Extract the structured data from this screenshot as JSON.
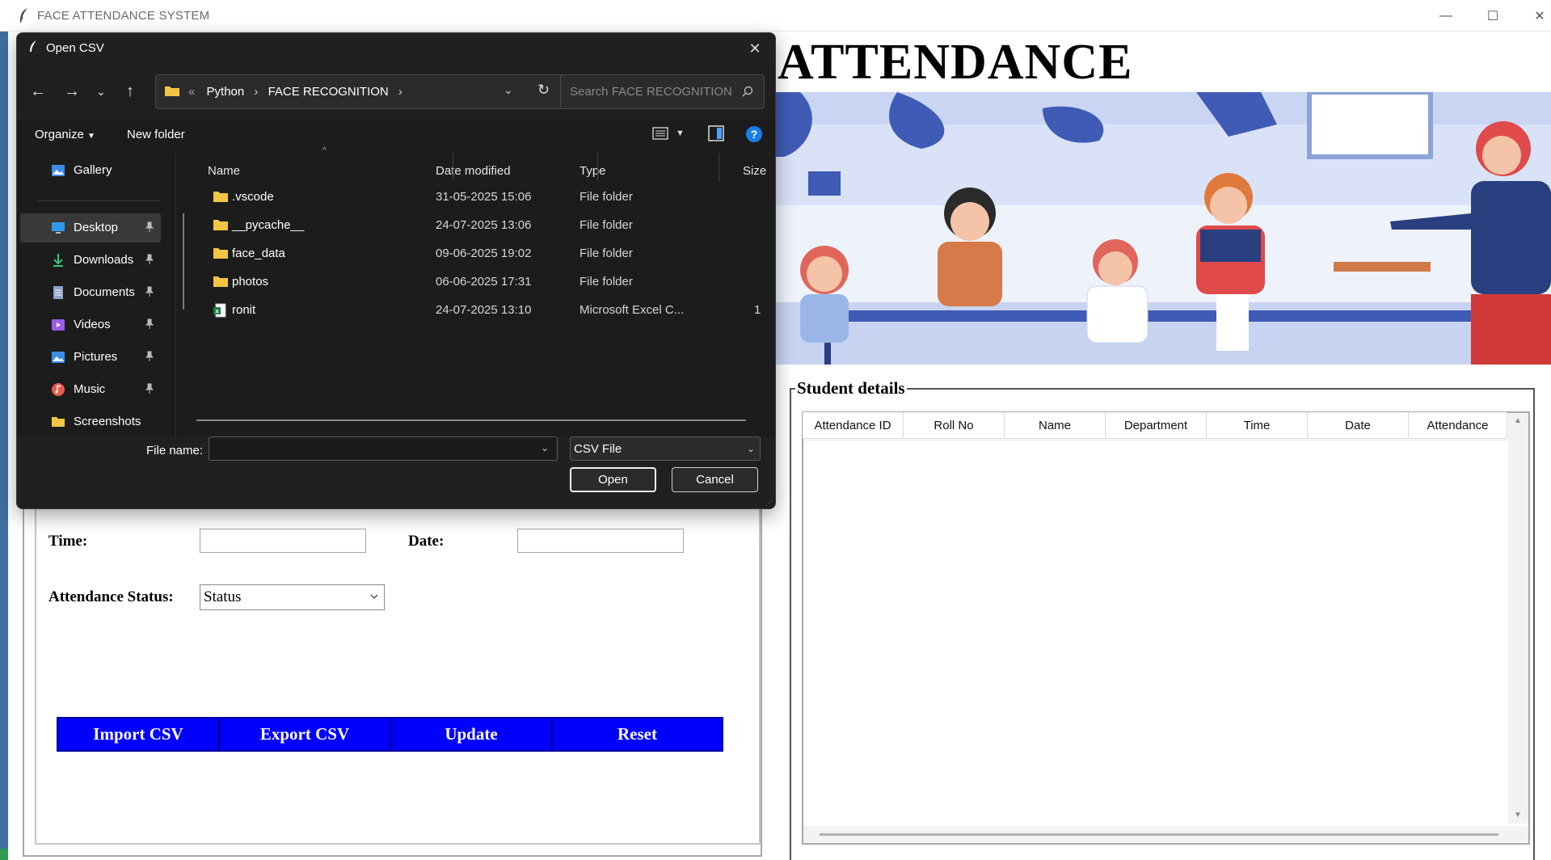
{
  "app": {
    "title": "FACE ATTENDANCE SYSTEM",
    "heading": "ATTENDANCE",
    "window_controls": {
      "minimize": "—",
      "maximize": "☐",
      "close": "✕"
    }
  },
  "form": {
    "time_label": "Time:",
    "time_value": "",
    "date_label": "Date:",
    "date_value": "",
    "status_label": "Attendance Status:",
    "status_value": "Status"
  },
  "buttons": {
    "import": "Import CSV",
    "export": "Export CSV",
    "update": "Update",
    "reset": "Reset"
  },
  "details": {
    "legend": "Student details",
    "columns": [
      "Attendance ID",
      "Roll No",
      "Name",
      "Department",
      "Time",
      "Date",
      "Attendance"
    ],
    "rows": []
  },
  "dialog": {
    "title": "Open CSV",
    "address": {
      "overflow": "«",
      "crumbs": [
        "Python",
        "FACE RECOGNITION"
      ]
    },
    "search_placeholder": "Search FACE RECOGNITION",
    "toolbar": {
      "organize": "Organize",
      "new_folder": "New folder"
    },
    "nav_items": [
      {
        "label": "Gallery",
        "icon": "gallery-icon",
        "pinned": false
      },
      {
        "label": "Desktop",
        "icon": "desktop-icon",
        "pinned": true,
        "selected": true
      },
      {
        "label": "Downloads",
        "icon": "downloads-icon",
        "pinned": true
      },
      {
        "label": "Documents",
        "icon": "documents-icon",
        "pinned": true
      },
      {
        "label": "Videos",
        "icon": "videos-icon",
        "pinned": true
      },
      {
        "label": "Pictures",
        "icon": "pictures-icon",
        "pinned": true
      },
      {
        "label": "Music",
        "icon": "music-icon",
        "pinned": true
      },
      {
        "label": "Screenshots",
        "icon": "folder-icon",
        "pinned": false
      }
    ],
    "columns": {
      "name": "Name",
      "date": "Date modified",
      "type": "Type",
      "size": "Size"
    },
    "files": [
      {
        "name": ".vscode",
        "date": "31-05-2025 15:06",
        "type": "File folder",
        "size": "",
        "icon": "folder-icon"
      },
      {
        "name": "__pycache__",
        "date": "24-07-2025 13:06",
        "type": "File folder",
        "size": "",
        "icon": "folder-icon"
      },
      {
        "name": "face_data",
        "date": "09-06-2025 19:02",
        "type": "File folder",
        "size": "",
        "icon": "folder-icon"
      },
      {
        "name": "photos",
        "date": "06-06-2025 17:31",
        "type": "File folder",
        "size": "",
        "icon": "folder-icon"
      },
      {
        "name": "ronit",
        "date": "24-07-2025 13:10",
        "type": "Microsoft Excel C...",
        "size": "1",
        "icon": "excel-csv-icon"
      }
    ],
    "filename_label": "File name:",
    "filename_value": "",
    "filetype_value": "CSV File",
    "open_label": "Open",
    "cancel_label": "Cancel"
  },
  "colors": {
    "button_blue": "#0000ff",
    "dialog_bg": "#1c1c1c",
    "folder_yellow": "#f4c542",
    "help_blue": "#1a7ee8"
  }
}
